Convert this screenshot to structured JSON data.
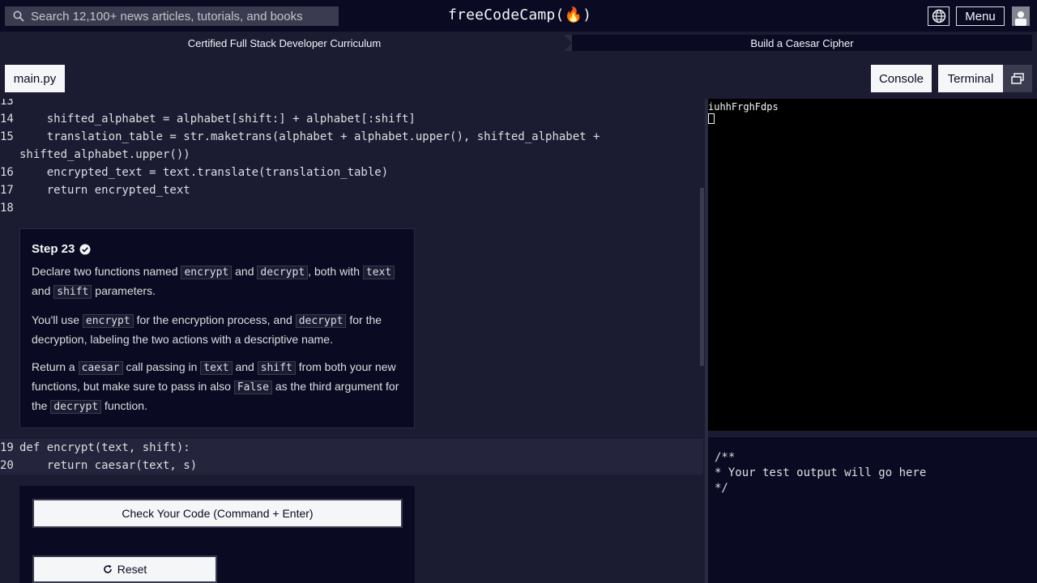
{
  "topnav": {
    "search_placeholder": "Search 12,100+ news articles, tutorials, and books",
    "brand": "freeCodeCamp(🔥)",
    "menu_label": "Menu"
  },
  "breadcrumbs": {
    "curriculum": "Certified Full Stack Developer Curriculum",
    "project": "Build a Caesar Cipher"
  },
  "tabs": {
    "file": "main.py",
    "console": "Console",
    "terminal": "Terminal"
  },
  "editor": {
    "lines_top": [
      {
        "n": "13",
        "code": ""
      },
      {
        "n": "14",
        "code": "    shifted_alphabet = alphabet[shift:] + alphabet[:shift]"
      },
      {
        "n": "15",
        "code": "    translation_table = str.maketrans(alphabet + alphabet.upper(), shifted_alphabet +"
      },
      {
        "n": "",
        "code": "shifted_alphabet.upper())"
      },
      {
        "n": "16",
        "code": "    encrypted_text = text.translate(translation_table)"
      },
      {
        "n": "17",
        "code": "    return encrypted_text"
      },
      {
        "n": "18",
        "code": ""
      }
    ],
    "lines_bottom": [
      {
        "n": "19",
        "code": "def encrypt(text, shift):"
      },
      {
        "n": "20",
        "code": "    return caesar(text, s)"
      }
    ]
  },
  "step": {
    "title": "Step 23",
    "p1": {
      "a": "Declare two functions named",
      "c1": "encrypt",
      "b": "and",
      "c2": "decrypt",
      "d": ", both with",
      "c3": "text",
      "e": "and",
      "c4": "shift",
      "f": "parameters."
    },
    "p2": {
      "a": "You'll use",
      "c1": "encrypt",
      "b": "for the encryption process, and",
      "c2": "decrypt",
      "d": "for the decryption, labeling the two actions with a descriptive name."
    },
    "p3": {
      "a": "Return a",
      "c1": "caesar",
      "b": "call passing in",
      "c2": "text",
      "c": "and",
      "c3": "shift",
      "d": "from both your new functions, but make sure to pass in also",
      "c4": "False",
      "e": "as the third argument for the",
      "c5": "decrypt",
      "f": "function."
    }
  },
  "buttons": {
    "check": "Check Your Code (Command + Enter)",
    "reset": "Reset"
  },
  "terminal": {
    "output": "iuhhFrghFdps"
  },
  "test_output": {
    "text": "/**\n* Your test output will go here\n*/"
  }
}
